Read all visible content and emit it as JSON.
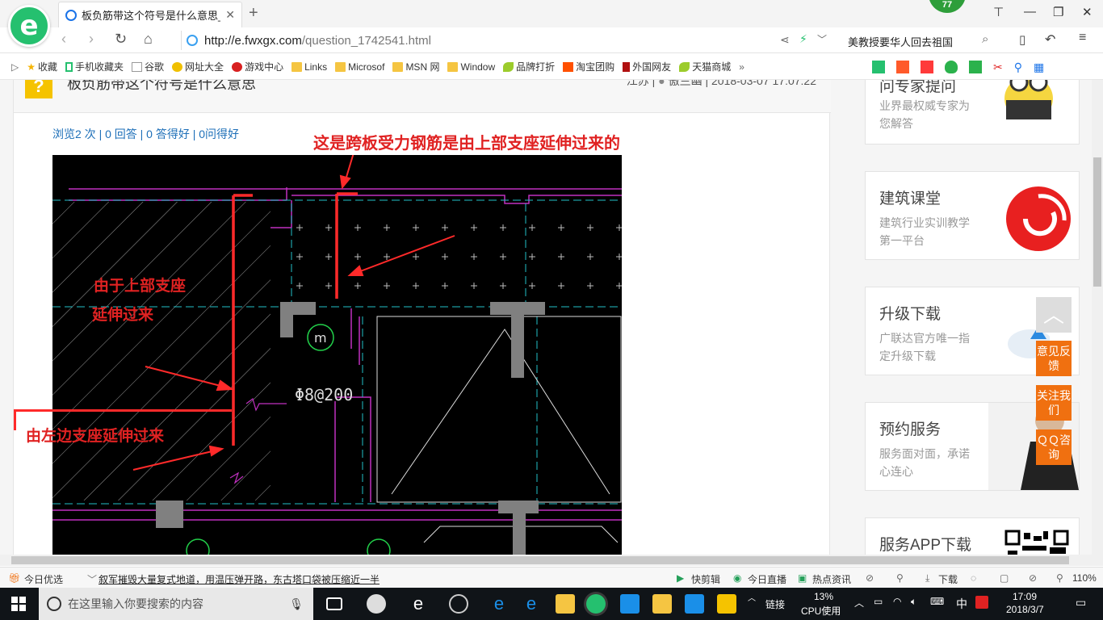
{
  "browser": {
    "tab_title": "板负筋带这个符号是什么意思_广",
    "badge_count": "77",
    "url_main": "http://e.fwxgx.com",
    "url_path": "/question_1742541.html",
    "news_ticker": "美教授要华人回去祖国"
  },
  "bookmarks": [
    {
      "label": "收藏",
      "icon": "star-icon"
    },
    {
      "label": "手机收藏夹",
      "icon": "phone-icon"
    },
    {
      "label": "谷歌",
      "icon": "page-icon"
    },
    {
      "label": "网址大全",
      "icon": "sites-icon"
    },
    {
      "label": "游戏中心",
      "icon": "game-icon"
    },
    {
      "label": "Links",
      "icon": "folder-icon"
    },
    {
      "label": "Microsof",
      "icon": "folder-icon"
    },
    {
      "label": "MSN 网",
      "icon": "folder-icon"
    },
    {
      "label": "Window",
      "icon": "folder-icon"
    },
    {
      "label": "品牌打折",
      "icon": "leaf-icon"
    },
    {
      "label": "淘宝团购",
      "icon": "taobao-icon"
    },
    {
      "label": "外国网友",
      "icon": "flag-icon"
    },
    {
      "label": "天猫商城",
      "icon": "leaf-icon"
    }
  ],
  "question": {
    "title": "板负筋带这个符号是什么意思",
    "region": "江苏",
    "user": "傲兰幽",
    "datetime": "2018-03-07 17:07:22",
    "stats": "浏览2 次 | 0 回答 | 0 答得好 | 0问得好"
  },
  "drawing": {
    "annotation_top": "这是跨板受力钢筋是由上部支座延伸过来的",
    "annotation_upper_1": "由于上部支座",
    "annotation_upper_2": "延伸过来",
    "annotation_left": "由左边支座延伸过来",
    "cad_label": "Φ8@200",
    "cad_circle": "m"
  },
  "sidebar": [
    {
      "title": "问专家提问",
      "desc": "业界最权威专家为您解答"
    },
    {
      "title": "建筑课堂",
      "desc": "建筑行业实训教学第一平台"
    },
    {
      "title": "升级下载",
      "desc": "广联达官方唯一指定升级下载"
    },
    {
      "title": "预约服务",
      "desc": "服务面对面，承诺心连心"
    },
    {
      "title": "服务APP下载",
      "desc": ""
    }
  ],
  "float_buttons": {
    "feedback": "意见反馈",
    "follow": "关注我们",
    "qq": "ＱＱ咨询"
  },
  "statusbar": {
    "daily": "今日优选",
    "news": "叙军摧毁大量复式地道，用温压弹开路，东古塔口袋被压缩近一半",
    "clip": "快剪辑",
    "live": "今日直播",
    "hot": "热点资讯",
    "download": "下载",
    "zoom": "110%"
  },
  "taskbar": {
    "search_placeholder": "在这里输入你要搜索的内容",
    "link": "链接",
    "cpu_pct": "13%",
    "cpu_label": "CPU使用",
    "ime": "中",
    "time": "17:09",
    "date": "2018/3/7"
  },
  "colors": {
    "accent_green": "#25c06f",
    "annotation_red": "#e02222",
    "float_orange": "#f07010",
    "link_blue": "#1d6fb8"
  }
}
